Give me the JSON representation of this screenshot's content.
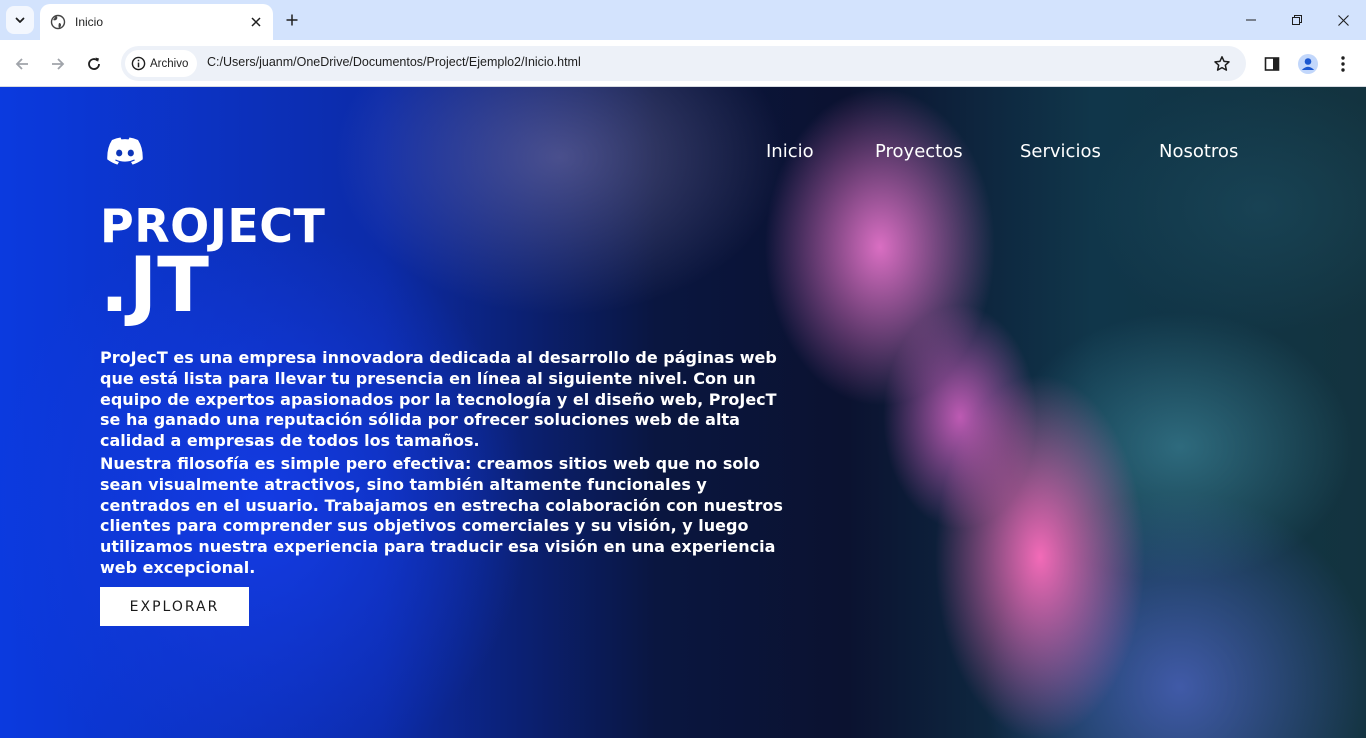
{
  "browser": {
    "tab_title": "Inicio",
    "chip_label": "Archivo",
    "url": "C:/Users/juanm/OneDrive/Documentos/Project/Ejemplo2/Inicio.html",
    "accent_color": "#d3e3fd"
  },
  "site": {
    "nav": [
      "Inicio",
      "Proyectos",
      "Servicios",
      "Nosotros"
    ],
    "hero_title_line1": "PROJECT",
    "hero_title_line2": ".JT",
    "paragraph1": "ProJecT es una empresa innovadora dedicada al desarrollo de páginas web que está lista para llevar tu presencia en línea al siguiente nivel. Con un equipo de expertos apasionados por la tecnología y el diseño web, ProJecT se ha ganado una reputación sólida por ofrecer soluciones web de alta calidad a empresas de todos los tamaños.",
    "paragraph2": "Nuestra filosofía es simple pero efectiva: creamos sitios web que no solo sean visualmente atractivos, sino también altamente funcionales y centrados en el usuario. Trabajamos en estrecha colaboración con nuestros clientes para comprender sus objetivos comerciales y su visión, y luego utilizamos nuestra experiencia para traducir esa visión en una experiencia web excepcional.",
    "cta_label": "EXPLORAR",
    "logo_icon": "discord-icon"
  }
}
